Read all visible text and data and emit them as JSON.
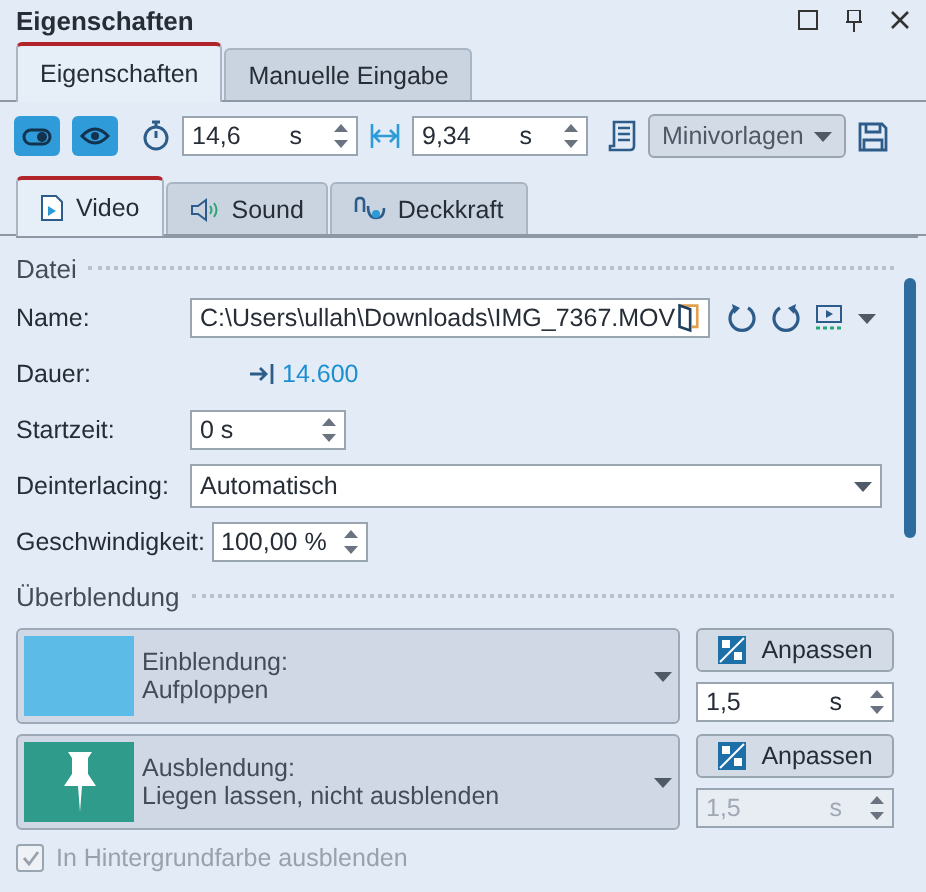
{
  "window": {
    "title": "Eigenschaften"
  },
  "tabs": [
    {
      "label": "Eigenschaften",
      "selected": true
    },
    {
      "label": "Manuelle Eingabe",
      "selected": false
    }
  ],
  "toolbar": {
    "toggles": [
      {
        "kind": "link",
        "on": true
      },
      {
        "kind": "eye",
        "on": true
      }
    ],
    "duration": {
      "value": "14,6",
      "unit": "s"
    },
    "transition_time": {
      "value": "9,34",
      "unit": "s"
    },
    "template_select": {
      "value": "Minivorlagen"
    }
  },
  "subtabs": [
    {
      "label": "Video",
      "kind": "video",
      "selected": true
    },
    {
      "label": "Sound",
      "kind": "sound",
      "selected": false
    },
    {
      "label": "Deckkraft",
      "kind": "opacity",
      "selected": false
    }
  ],
  "file_section": {
    "title": "Datei",
    "fields": [
      {
        "kind": "path",
        "label": "Name:",
        "value": "C:\\Users\\ullah\\Downloads\\IMG_7367.MOV"
      },
      {
        "kind": "duration",
        "label": "Dauer:",
        "value": "14.600"
      },
      {
        "kind": "spinner",
        "label": "Startzeit:",
        "value": "0 s"
      },
      {
        "kind": "dropdown",
        "label": "Deinterlacing:",
        "value": "Automatisch"
      },
      {
        "kind": "spinner",
        "label": "Geschwindigkeit:",
        "value": "100,00 %"
      }
    ]
  },
  "transition_section": {
    "title": "Überblendung",
    "items": [
      {
        "kind": "in",
        "label": "Einblendung:",
        "value": "Aufploppen",
        "button": "Anpassen",
        "duration": {
          "value": "1,5",
          "unit": "s",
          "disabled": false
        }
      },
      {
        "kind": "out",
        "label": "Ausblendung:",
        "value": "Liegen lassen, nicht ausblenden",
        "button": "Anpassen",
        "duration": {
          "value": "1,5",
          "unit": "s",
          "disabled": true
        }
      }
    ]
  },
  "background_option": {
    "label": "In Hintergrundfarbe ausblenden",
    "checked": true,
    "disabled": true
  }
}
